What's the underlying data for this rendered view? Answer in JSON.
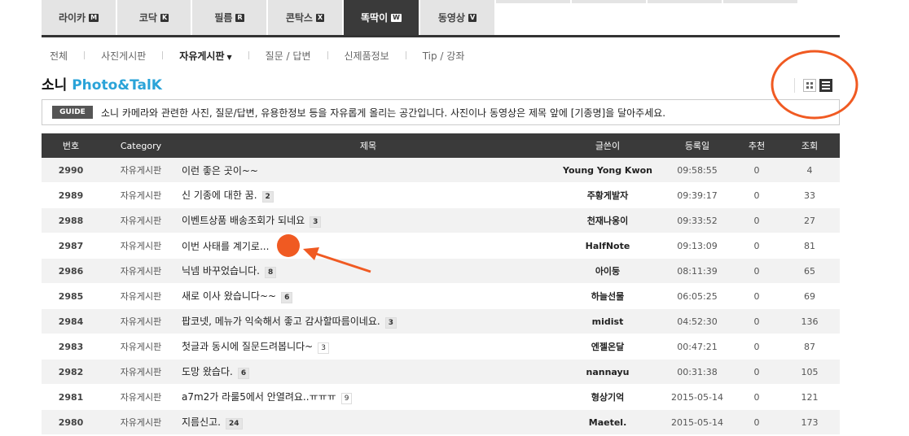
{
  "tabs": [
    {
      "label": "라이카",
      "key": "M"
    },
    {
      "label": "코닥",
      "key": "K"
    },
    {
      "label": "필름",
      "key": "R"
    },
    {
      "label": "콘탁스",
      "key": "X"
    },
    {
      "label": "똑딱이",
      "key": "W"
    },
    {
      "label": "동영상",
      "key": "V"
    }
  ],
  "subnav": [
    "전체",
    "사진게시판",
    "자유게시판",
    "질문 / 답변",
    "신제품정보",
    "Tip / 강좌"
  ],
  "title": {
    "main": "소니",
    "brand": "Photo&TalK"
  },
  "guide": {
    "label": "GUIDE",
    "text": "소니 카메라와 관련한 사진, 질문/답변, 유용한정보 등을 자유롭게 올리는 공간입니다. 사진이나 동영상은 제목 앞에 [기종명]을 달아주세요."
  },
  "table": {
    "headers": {
      "no": "번호",
      "category": "Category",
      "title": "제목",
      "author": "글쓴이",
      "date": "등록일",
      "rec": "추천",
      "views": "조회"
    },
    "rows": [
      {
        "no": "2990",
        "category": "자유게시판",
        "title": "이런 좋은 곳이~~",
        "comments": "",
        "author": "Young Yong Kwon",
        "date": "09:58:55",
        "rec": "0",
        "views": "4"
      },
      {
        "no": "2989",
        "category": "자유게시판",
        "title": "신 기종에 대한 꿈.",
        "comments": "2",
        "author": "주황게발자",
        "date": "09:39:17",
        "rec": "0",
        "views": "33"
      },
      {
        "no": "2988",
        "category": "자유게시판",
        "title": "이벤트상품 배송조회가 되네요",
        "comments": "3",
        "author": "천재나옹이",
        "date": "09:33:52",
        "rec": "0",
        "views": "27"
      },
      {
        "no": "2987",
        "category": "자유게시판",
        "title": "이번 사태를 계기로...",
        "comments": "",
        "author": "HalfNote",
        "date": "09:13:09",
        "rec": "0",
        "views": "81"
      },
      {
        "no": "2986",
        "category": "자유게시판",
        "title": "닉넴 바꾸었습니다.",
        "comments": "8",
        "author": "아이둥",
        "date": "08:11:39",
        "rec": "0",
        "views": "65"
      },
      {
        "no": "2985",
        "category": "자유게시판",
        "title": "새로 이사 왔습니다~~",
        "comments": "6",
        "author": "하늘선물",
        "date": "06:05:25",
        "rec": "0",
        "views": "69"
      },
      {
        "no": "2984",
        "category": "자유게시판",
        "title": "팝코넷, 메뉴가 익숙해서 좋고 감사할따름이네요.",
        "comments": "3",
        "author": "midist",
        "date": "04:52:30",
        "rec": "0",
        "views": "136"
      },
      {
        "no": "2983",
        "category": "자유게시판",
        "title": "첫글과 동시에 질문드려봅니다~",
        "comments": "3",
        "author": "엔젤온달",
        "date": "00:47:21",
        "rec": "0",
        "views": "87"
      },
      {
        "no": "2982",
        "category": "자유게시판",
        "title": "도망 왔습다.",
        "comments": "6",
        "author": "nannayu",
        "date": "00:31:38",
        "rec": "0",
        "views": "105"
      },
      {
        "no": "2981",
        "category": "자유게시판",
        "title": "a7m2가 라룰5에서 안열려요..ㅠㅠㅠ",
        "comments": "9",
        "author": "형상기억",
        "date": "2015-05-14",
        "rec": "0",
        "views": "121"
      },
      {
        "no": "2980",
        "category": "자유게시판",
        "title": "지름신고.",
        "comments": "24",
        "author": "Maetel.",
        "date": "2015-05-14",
        "rec": "0",
        "views": "173"
      }
    ]
  },
  "colors": {
    "accent": "#2aa3d8",
    "annotation": "#f05a22",
    "header_bg": "#3a3a3a"
  },
  "icons": {
    "grid": "grid-view-icon",
    "list": "list-view-icon"
  }
}
